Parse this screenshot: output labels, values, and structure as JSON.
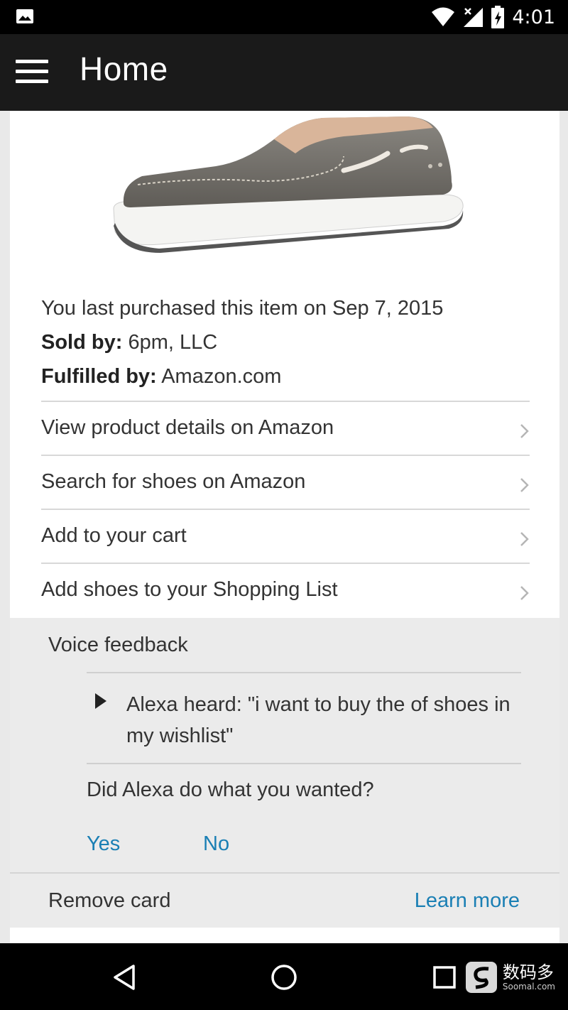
{
  "status_bar": {
    "time": "4:01",
    "icons": [
      "image-notification-icon",
      "wifi-icon",
      "signal-icon",
      "battery-charging-icon"
    ]
  },
  "app_bar": {
    "title": "Home",
    "menu_icon": "hamburger-menu-icon"
  },
  "card": {
    "product_image": "gray-canvas-slip-on-shoe",
    "last_purchased": "You last purchased this item on Sep 7, 2015",
    "sold_by_label": "Sold by:",
    "sold_by_value": "6pm, LLC",
    "fulfilled_by_label": "Fulfilled by:",
    "fulfilled_by_value": "Amazon.com",
    "actions": [
      {
        "label": "View product details on Amazon"
      },
      {
        "label": "Search for shoes on Amazon"
      },
      {
        "label": "Add to your cart"
      },
      {
        "label": "Add shoes to your Shopping List"
      }
    ]
  },
  "feedback": {
    "title": "Voice feedback",
    "heard": "Alexa heard: \"i want to buy the of shoes in my wishlist\"",
    "question": "Did Alexa do what you wanted?",
    "yes": "Yes",
    "no": "No",
    "remove": "Remove card",
    "learn_more": "Learn more"
  },
  "colors": {
    "link": "#1a7fb4",
    "app_bar": "#1a1a1a",
    "feedback_bg": "#ebebeb"
  },
  "nav_bar": {
    "buttons": [
      "back-icon",
      "home-icon",
      "recents-icon"
    ],
    "watermark_main": "数码多",
    "watermark_sub": "Soomal.com"
  }
}
